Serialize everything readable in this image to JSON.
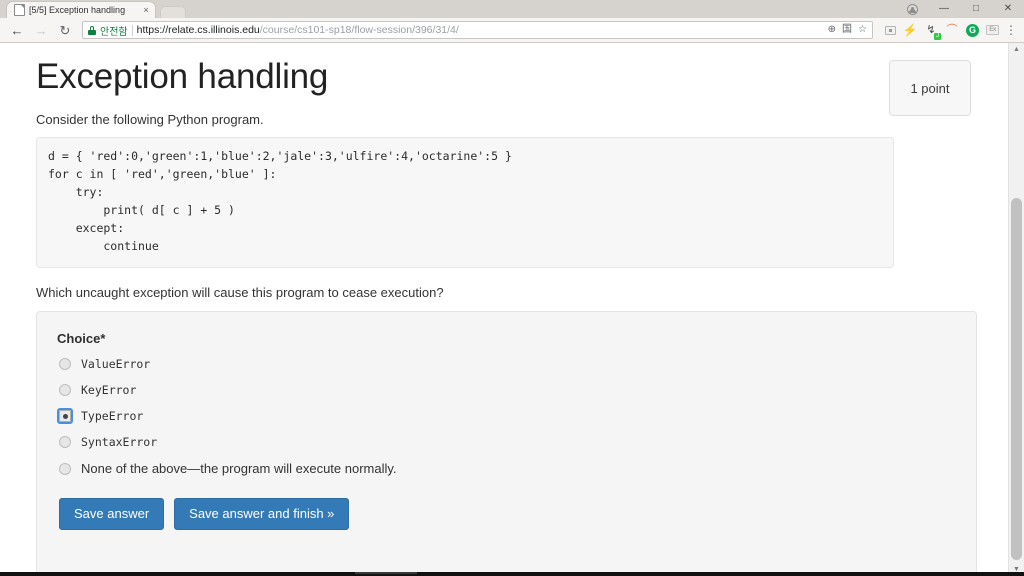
{
  "browser": {
    "tab": {
      "title": "[5/5] Exception handling",
      "favicon": "page-icon",
      "close_label": "×"
    },
    "window_controls": {
      "profile": "profile-icon",
      "minimize": "—",
      "maximize": "□",
      "close": "✕"
    },
    "nav": {
      "back": "←",
      "forward": "→",
      "reload": "↻"
    },
    "omnibox": {
      "secure_label": "안전함",
      "separator": "|",
      "url_scheme": "https://",
      "url_host": "relate.cs.illinois.edu",
      "url_path": "/course/cs101-sp18/flow-session/396/31/4/",
      "zoom_icon": "⊕",
      "translate_icon": "国",
      "bookmark_icon": "☆"
    },
    "extensions": [
      {
        "name": "screenshot-extension-icon",
        "glyph": ""
      },
      {
        "name": "lightning-extension-icon",
        "glyph": "⚡"
      },
      {
        "name": "json-extension-icon",
        "glyph": "↯"
      },
      {
        "name": "curve-extension-icon",
        "glyph": "⌒"
      },
      {
        "name": "grammarly-extension-icon",
        "glyph": "G"
      },
      {
        "name": "ex-extension-icon",
        "glyph": "Ex"
      },
      {
        "name": "chrome-menu-icon",
        "glyph": "⋮"
      }
    ]
  },
  "page": {
    "title": "Exception handling",
    "point_badge": "1 point",
    "lead": "Consider the following Python program.",
    "code": "d = { 'red':0,'green':1,'blue':2,'jale':3,'ulfire':4,'octarine':5 }\nfor c in [ 'red','green,'blue' ]:\n    try:\n        print( d[ c ] + 5 )\n    except:\n        continue",
    "question": "Which uncaught exception will cause this program to cease execution?",
    "choice_legend": "Choice*",
    "choices": [
      {
        "label": "ValueError",
        "mono": true,
        "selected": false
      },
      {
        "label": "KeyError",
        "mono": true,
        "selected": false
      },
      {
        "label": "TypeError",
        "mono": true,
        "selected": true
      },
      {
        "label": "SyntaxError",
        "mono": true,
        "selected": false
      },
      {
        "label": "None of the above—the program will execute normally.",
        "mono": false,
        "selected": false
      }
    ],
    "buttons": {
      "save": "Save answer",
      "save_finish": "Save answer and finish »"
    },
    "accent_color": "#337ab7"
  }
}
